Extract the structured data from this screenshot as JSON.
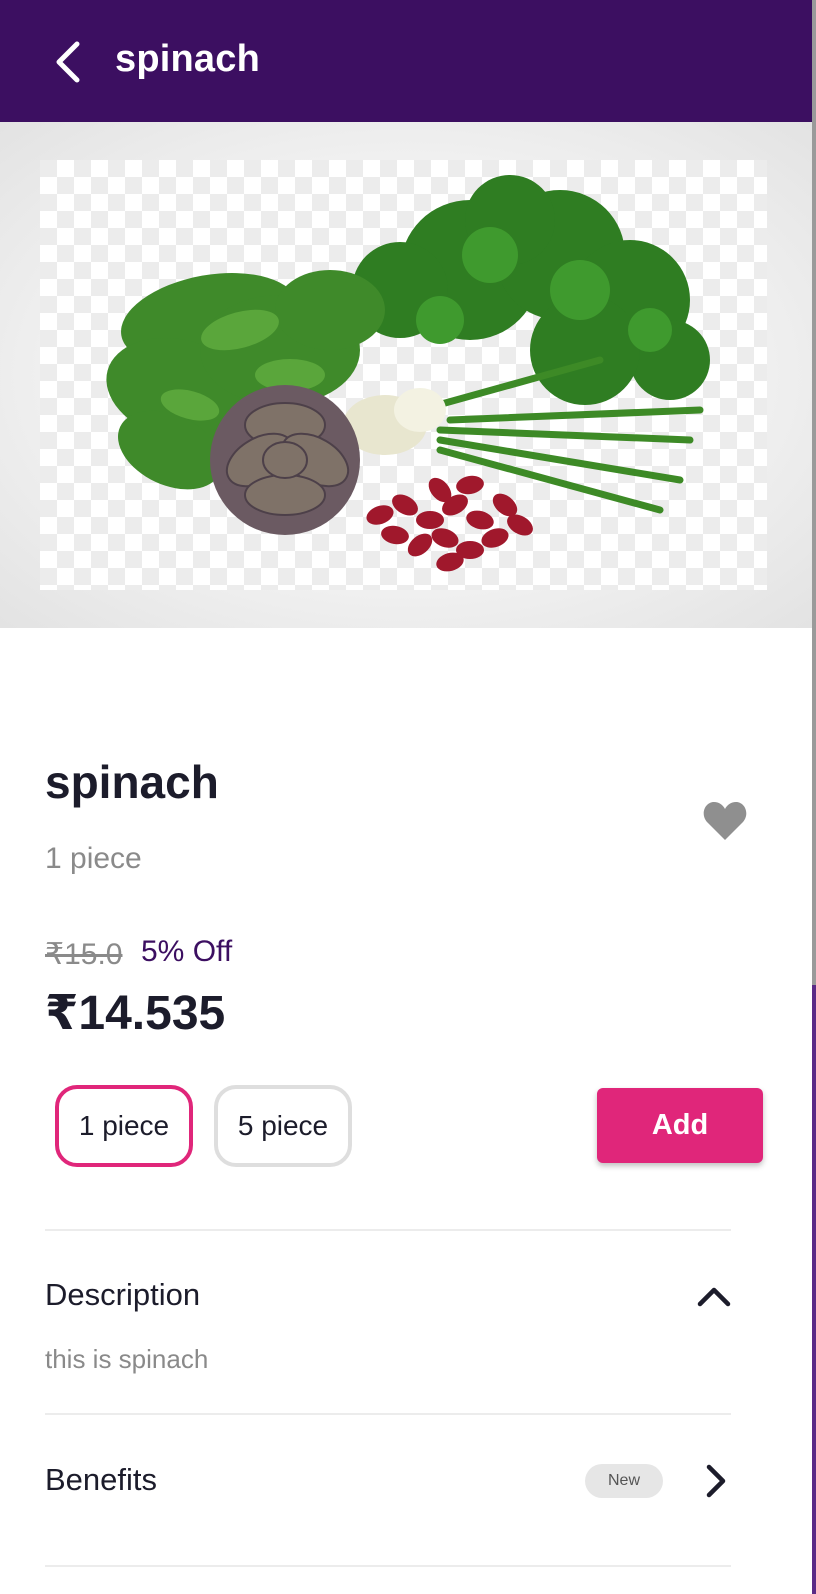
{
  "header": {
    "title": "spinach",
    "back_icon": "arrow-left-icon",
    "background": "#3c0f61"
  },
  "product": {
    "name": "spinach",
    "unit": "1 piece",
    "original_price": "₹15.0",
    "discount": "5% Off",
    "price": "₹14.535",
    "favorite_icon": "heart-icon"
  },
  "variants": [
    {
      "label": "1 piece",
      "selected": true
    },
    {
      "label": "5 piece",
      "selected": false
    }
  ],
  "add_button": {
    "label": "Add",
    "color": "#e0267a"
  },
  "description": {
    "heading": "Description",
    "text": "this is spinach",
    "icon": "chevron-up-icon"
  },
  "benefits": {
    "heading": "Benefits",
    "badge": "New",
    "icon": "chevron-right-icon"
  }
}
